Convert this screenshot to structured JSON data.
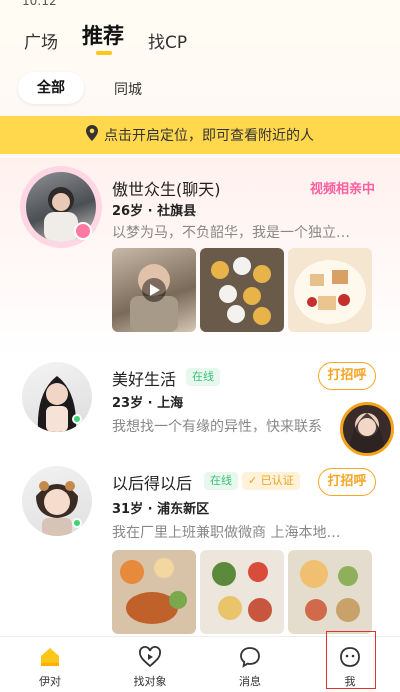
{
  "status": {
    "time": "10:12",
    "right": "▾ ▮"
  },
  "top_tabs": [
    "广场",
    "推荐",
    "找CP"
  ],
  "filters": {
    "all": "全部",
    "city": "同城"
  },
  "location_banner": {
    "text": "点击开启定位，即可查看附近的人"
  },
  "cards": [
    {
      "name": "傲世众生(聊天)",
      "meta": "26岁 · 社旗县",
      "bio": "以梦为马，不负韶华，我是一个独立…",
      "status": "视频相亲中"
    },
    {
      "name": "美好生活",
      "online": "在线",
      "meta": "23岁 · 上海",
      "bio": "我想找一个有缘的异性，快来联系",
      "action": "打招呼"
    },
    {
      "name": "以后得以后",
      "online": "在线",
      "verified": "已认证",
      "meta": "31岁 · 浦东新区",
      "bio": "我在厂里上班兼职做微商  上海本地…",
      "action": "打招呼"
    }
  ],
  "nav": [
    {
      "label": "伊对",
      "icon": "home-icon"
    },
    {
      "label": "找对象",
      "icon": "heart-icon"
    },
    {
      "label": "消息",
      "icon": "message-icon"
    },
    {
      "label": "我",
      "icon": "profile-icon"
    }
  ],
  "colors": {
    "accent": "#ffc61a",
    "banner": "#ffd84d",
    "greet": "#f5a623",
    "video": "#ff5fa0",
    "online": "#3cc07a"
  }
}
